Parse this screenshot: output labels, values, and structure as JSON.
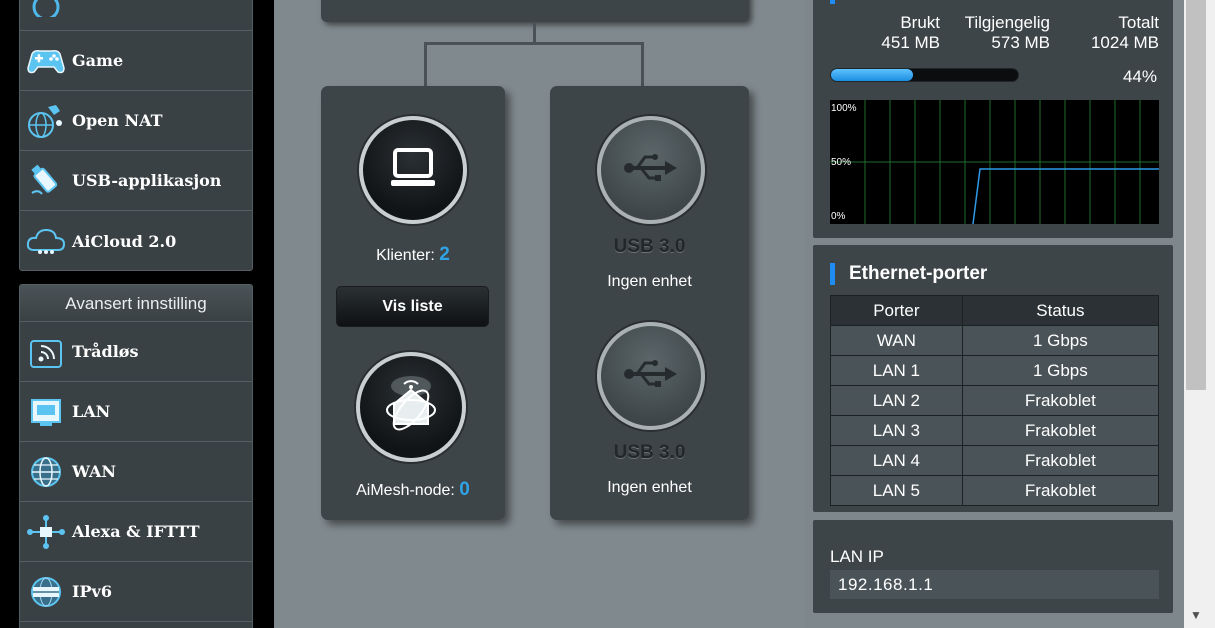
{
  "sidebar": {
    "items_top": [
      {
        "label": "Game",
        "icon": "gamepad-icon"
      },
      {
        "label": "Open NAT",
        "icon": "open-nat-icon"
      },
      {
        "label": "USB-applikasjon",
        "icon": "usb-app-icon"
      },
      {
        "label": "AiCloud 2.0",
        "icon": "cloud-icon"
      }
    ],
    "advanced_header": "Avansert innstilling",
    "items_advanced": [
      {
        "label": "Trådløs",
        "icon": "wifi-icon"
      },
      {
        "label": "LAN",
        "icon": "lan-icon"
      },
      {
        "label": "WAN",
        "icon": "globe-icon"
      },
      {
        "label": "Alexa & IFTTT",
        "icon": "alexa-ifttt-icon"
      },
      {
        "label": "IPv6",
        "icon": "ipv6-icon"
      }
    ]
  },
  "network_map": {
    "clients_label": "Klienter:",
    "clients_count": "2",
    "view_list_button": "Vis liste",
    "aimesh_label": "AiMesh-node:",
    "aimesh_count": "0",
    "usb_ports": [
      {
        "label": "USB 3.0",
        "status": "Ingen enhet"
      },
      {
        "label": "USB 3.0",
        "status": "Ingen enhet"
      }
    ]
  },
  "memory": {
    "used_label": "Brukt",
    "used_value": "451 MB",
    "available_label": "Tilgjengelig",
    "available_value": "573 MB",
    "total_label": "Totalt",
    "total_value": "1024 MB",
    "percent_text": "44%",
    "percent": 44,
    "chart_ticks": [
      "100%",
      "50%",
      "0%"
    ]
  },
  "ethernet": {
    "title": "Ethernet-porter",
    "headers": [
      "Porter",
      "Status"
    ],
    "rows": [
      [
        "WAN",
        "1 Gbps"
      ],
      [
        "LAN 1",
        "1 Gbps"
      ],
      [
        "LAN 2",
        "Frakoblet"
      ],
      [
        "LAN 3",
        "Frakoblet"
      ],
      [
        "LAN 4",
        "Frakoblet"
      ],
      [
        "LAN 5",
        "Frakoblet"
      ]
    ]
  },
  "lan_ip": {
    "label": "LAN IP",
    "value": "192.168.1.1"
  },
  "colors": {
    "accent": "#2fa3e6",
    "panel": "#3e4548",
    "background": "#808a8e"
  }
}
